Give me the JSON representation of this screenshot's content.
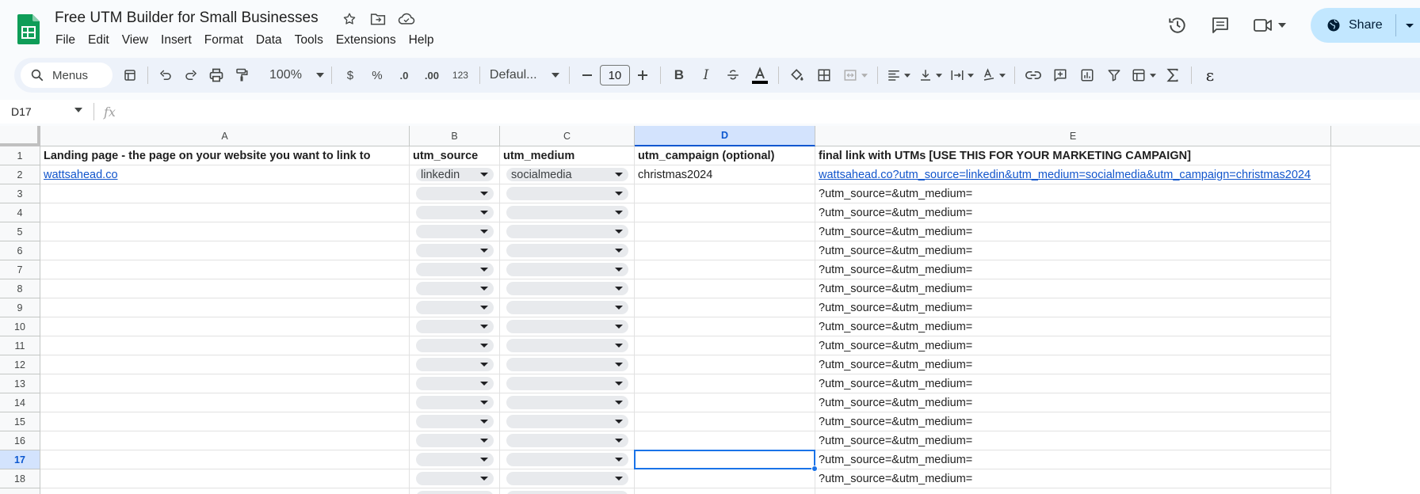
{
  "app": {
    "document_title": "Free UTM Builder for Small Businesses",
    "menu": [
      "File",
      "Edit",
      "View",
      "Insert",
      "Format",
      "Data",
      "Tools",
      "Extensions",
      "Help"
    ],
    "share_label": "Share",
    "brand_color": "#0f9d58"
  },
  "toolbar": {
    "search_label": "Menus",
    "zoom": "100%",
    "currency": "$",
    "percent": "%",
    "dec_decrease": ".0",
    "dec_increase": ".00",
    "number_format": "123",
    "font": "Defaul...",
    "font_size": "10",
    "bold": "B",
    "italic": "I"
  },
  "formula_bar": {
    "name_box": "D17",
    "fx": "fx",
    "content": ""
  },
  "sheet": {
    "columns": [
      "A",
      "B",
      "C",
      "D",
      "E"
    ],
    "selected_column": "D",
    "selected_row": 17,
    "rows": [
      {
        "num": "1",
        "a": "Landing page - the page on your website you want to link to",
        "b": "utm_source",
        "c": "utm_medium",
        "d": "utm_campaign (optional)",
        "e": "final link with UTMs [USE THIS FOR YOUR MARKETING CAMPAIGN]"
      },
      {
        "num": "2",
        "a": "wattsahead.co",
        "b": "linkedin",
        "c": "socialmedia",
        "d": "christmas2024",
        "e": "wattsahead.co?utm_source=linkedin&utm_medium=socialmedia&utm_campaign=christmas2024"
      },
      {
        "num": "3",
        "a": "",
        "b": "",
        "c": "",
        "d": "",
        "e": "?utm_source=&utm_medium="
      },
      {
        "num": "4",
        "a": "",
        "b": "",
        "c": "",
        "d": "",
        "e": "?utm_source=&utm_medium="
      },
      {
        "num": "5",
        "a": "",
        "b": "",
        "c": "",
        "d": "",
        "e": "?utm_source=&utm_medium="
      },
      {
        "num": "6",
        "a": "",
        "b": "",
        "c": "",
        "d": "",
        "e": "?utm_source=&utm_medium="
      },
      {
        "num": "7",
        "a": "",
        "b": "",
        "c": "",
        "d": "",
        "e": "?utm_source=&utm_medium="
      },
      {
        "num": "8",
        "a": "",
        "b": "",
        "c": "",
        "d": "",
        "e": "?utm_source=&utm_medium="
      },
      {
        "num": "9",
        "a": "",
        "b": "",
        "c": "",
        "d": "",
        "e": "?utm_source=&utm_medium="
      },
      {
        "num": "10",
        "a": "",
        "b": "",
        "c": "",
        "d": "",
        "e": "?utm_source=&utm_medium="
      },
      {
        "num": "11",
        "a": "",
        "b": "",
        "c": "",
        "d": "",
        "e": "?utm_source=&utm_medium="
      },
      {
        "num": "12",
        "a": "",
        "b": "",
        "c": "",
        "d": "",
        "e": "?utm_source=&utm_medium="
      },
      {
        "num": "13",
        "a": "",
        "b": "",
        "c": "",
        "d": "",
        "e": "?utm_source=&utm_medium="
      },
      {
        "num": "14",
        "a": "",
        "b": "",
        "c": "",
        "d": "",
        "e": "?utm_source=&utm_medium="
      },
      {
        "num": "15",
        "a": "",
        "b": "",
        "c": "",
        "d": "",
        "e": "?utm_source=&utm_medium="
      },
      {
        "num": "16",
        "a": "",
        "b": "",
        "c": "",
        "d": "",
        "e": "?utm_source=&utm_medium="
      },
      {
        "num": "17",
        "a": "",
        "b": "",
        "c": "",
        "d": "",
        "e": "?utm_source=&utm_medium="
      },
      {
        "num": "18",
        "a": "",
        "b": "",
        "c": "",
        "d": "",
        "e": "?utm_source=&utm_medium="
      },
      {
        "num": "",
        "a": "",
        "b": "",
        "c": "",
        "d": "",
        "e": ""
      }
    ]
  }
}
